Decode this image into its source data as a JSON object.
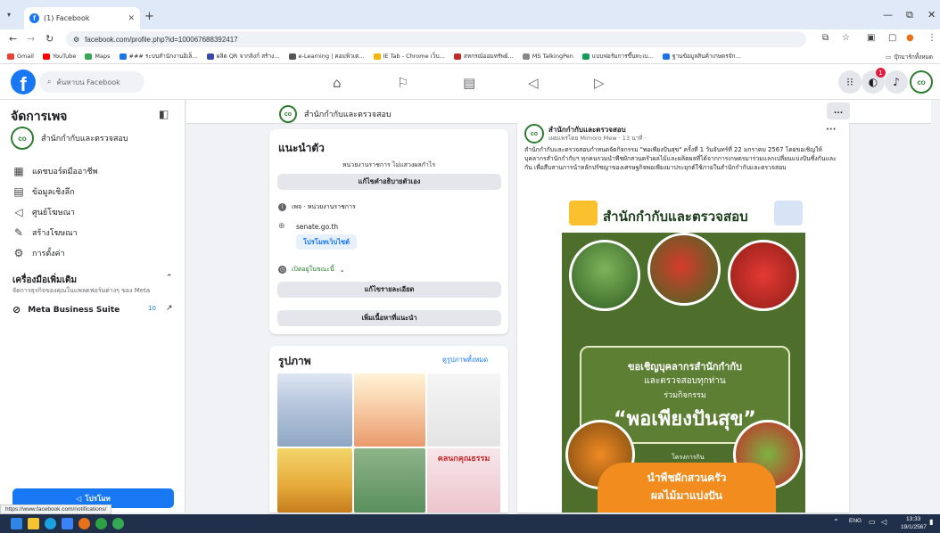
{
  "browser": {
    "tab_title": "(1) Facebook",
    "url": "facebook.com/profile.php?id=100067688392417",
    "bookmarks": [
      "Gmail",
      "YouTube",
      "Maps",
      "### ระบบสำนักงานอิเล็...",
      "ผลิต QR จากลิงก์ สร้าง...",
      "e-Learning | คอมพิวเต...",
      "IE Tab - Chrome เว็บ...",
      "สหกรณ์ออมทรัพย์...",
      "MS TalkingPen",
      "แบบฟอร์มการขึ้นทะเบ...",
      "ฐานข้อมูลสินค้าเกษตรจัก..."
    ],
    "bookmarks_right": "บุ๊กมาร์กทั้งหมด"
  },
  "facebook": {
    "search_placeholder": "ค้นหาบน Facebook",
    "notification_count": "1"
  },
  "sidebar": {
    "title": "จัดการเพจ",
    "page_name": "สำนักกำกับและตรวจสอบ",
    "items": [
      {
        "label": "แดชบอร์ดมืออาชีพ",
        "icon": "dashboard-icon"
      },
      {
        "label": "ข้อมูลเชิงลึก",
        "icon": "insights-icon"
      },
      {
        "label": "ศูนย์โฆษณา",
        "icon": "megaphone-icon"
      },
      {
        "label": "สร้างโฆษณา",
        "icon": "edit-icon"
      },
      {
        "label": "การตั้งค่า",
        "icon": "gear-icon"
      }
    ],
    "tools_title": "เครื่องมือเพิ่มเติม",
    "tools_subtitle": "จัดการธุรกิจของคุณในแพลตฟอร์มต่างๆ ของ Meta",
    "meta_suite": "Meta Business Suite",
    "meta_count": "10",
    "promote_label": "โปรโมท"
  },
  "page_header": {
    "name": "สำนักกำกับและตรวจสอบ",
    "more": "..."
  },
  "intro": {
    "title": "แนะนำตัว",
    "description": "หน่วยงานราชการ ไม่แสวงผลกำไร",
    "edit_bio": "แก้ไขคำอธิบายตัวเอง",
    "category": "เพจ · หน่วยงานราชการ",
    "website": "senate.go.th",
    "promote_website": "โปรโมทเว็บไซต์",
    "hours": "เปิดอยู่ในขณะนี้",
    "edit_details": "แก้ไขรายละเอียด",
    "add_featured": "เพิ่มเนื้อหาที่แนะนำ"
  },
  "photos": {
    "title": "รูปภาพ",
    "see_all": "ดูรูปภาพทั้งหมด",
    "thumb_caption": "คลนกคุณธรรม"
  },
  "post": {
    "author": "สำนักกำกับและตรวจสอบ",
    "meta": "เผยแพร่โดย Mimoro Mew · 13 นาที ·",
    "text": "สำนักกำกับและตรวจสอบกำหนดจัดกิจกรรม \"พอเพียงปันสุข\" ครั้งที่ 1 วันจันทร์ที่ 22 มกราคม 2567 โดยขอเชิญให้บุคลากรสำนักกำกับฯ ทุกคนรวมนำพืชผักสวนครัวผลไม้และผลิตผลที่ได้จากการเกษตรมาร่วมแลกเปลี่ยนแบ่งปันซึ่งกันและกัน เพื่อสืบสานการนำหลักปรัชญาของเศรษฐกิจพอเพียงมาประยุกต์ใช้ภายในสำนักกำกับและตรวจสอบ",
    "poster": {
      "title": "สำนักกำกับและตรวจสอบ",
      "line1": "ขอเชิญบุคลากรสำนักกำกับ",
      "line2": "และตรวจสอบทุกท่าน",
      "line3": "ร่วมกิจกรรม",
      "headline": "“พอเพียงปันสุข”",
      "project": "โครงการกิน",
      "banner1": "นำพืชผักสวนครัว",
      "banner2": "ผลไม้มาแบ่งปัน"
    }
  },
  "status_url": "https://www.facebook.com/notifications/",
  "taskbar": {
    "lang": "ENG",
    "time": "13:33",
    "date": "19/1/2567"
  }
}
